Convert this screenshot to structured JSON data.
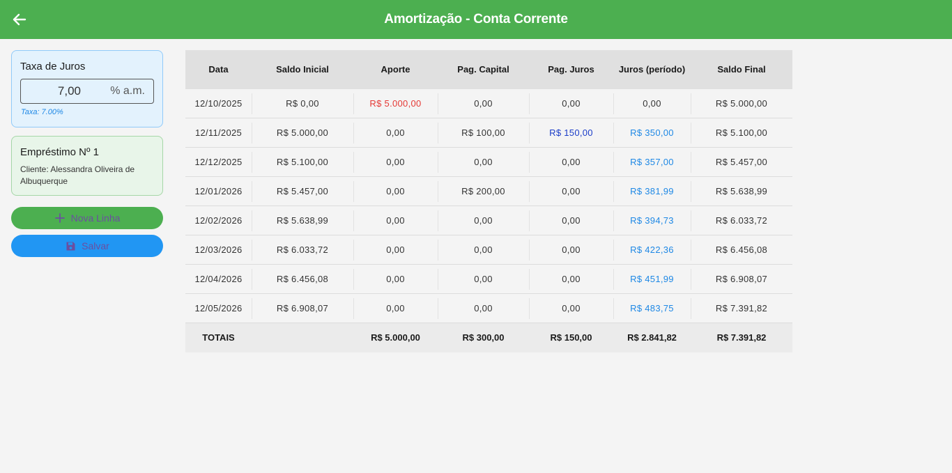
{
  "app": {
    "title": "Amortização - Conta Corrente",
    "accent_color": "#4caf50",
    "back_icon": "arrow-left-icon"
  },
  "rate": {
    "title": "Taxa de Juros",
    "value": "7,00",
    "suffix": "% a.m.",
    "helper": "Taxa: 7.00%"
  },
  "loan": {
    "title": "Empréstimo Nº 1",
    "client": "Cliente: Alessandra Oliveira de Albuquerque"
  },
  "actions": {
    "new_row_label": "Nova Linha",
    "new_row_icon": "plus-icon",
    "save_label": "Salvar",
    "save_icon": "floppy-disk-icon"
  },
  "table": {
    "headers": [
      "Data",
      "Saldo Inicial",
      "Aporte",
      "Pag. Capital",
      "Pag. Juros",
      "Juros (período)",
      "Saldo Final"
    ],
    "rows": [
      [
        "12/10/2025",
        "R$ 0,00",
        "R$ 5.000,00",
        "0,00",
        "0,00",
        "0,00",
        "R$ 5.000,00"
      ],
      [
        "12/11/2025",
        "R$ 5.000,00",
        "0,00",
        "R$ 100,00",
        "R$ 150,00",
        "R$ 350,00",
        "R$ 5.100,00"
      ],
      [
        "12/12/2025",
        "R$ 5.100,00",
        "0,00",
        "0,00",
        "0,00",
        "R$ 357,00",
        "R$ 5.457,00"
      ],
      [
        "12/01/2026",
        "R$ 5.457,00",
        "0,00",
        "R$ 200,00",
        "0,00",
        "R$ 381,99",
        "R$ 5.638,99"
      ],
      [
        "12/02/2026",
        "R$ 5.638,99",
        "0,00",
        "0,00",
        "0,00",
        "R$ 394,73",
        "R$ 6.033,72"
      ],
      [
        "12/03/2026",
        "R$ 6.033,72",
        "0,00",
        "0,00",
        "0,00",
        "R$ 422,36",
        "R$ 6.456,08"
      ],
      [
        "12/04/2026",
        "R$ 6.456,08",
        "0,00",
        "0,00",
        "0,00",
        "R$ 451,99",
        "R$ 6.908,07"
      ],
      [
        "12/05/2026",
        "R$ 6.908,07",
        "0,00",
        "0,00",
        "0,00",
        "R$ 483,75",
        "R$ 7.391,82"
      ]
    ],
    "totals": [
      "TOTAIS",
      "",
      "R$ 5.000,00",
      "R$ 300,00",
      "R$ 150,00",
      "R$ 2.841,82",
      "R$ 7.391,82"
    ],
    "colors": {
      "aporte_positive": "#e53935",
      "pag_juros_positive": "#1a3cc8",
      "juros_positive": "#1e88e5"
    }
  }
}
